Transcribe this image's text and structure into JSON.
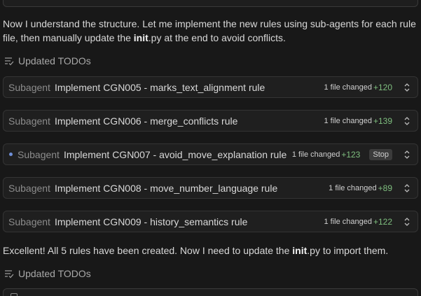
{
  "intro": {
    "before_bold_1": "Now I understand the structure. Let me implement the new rules using sub-agents for each rule file, then manually update the ",
    "bold_1": "init",
    "after_bold_1": ".py at the end to avoid conflicts."
  },
  "todos": [
    {
      "label": "Updated TODOs",
      "icon": "checklist-icon"
    },
    {
      "label": "Updated TODOs",
      "icon": "checklist-icon"
    }
  ],
  "subagents": [
    {
      "prefix": "Subagent",
      "title": "Implement CGN005 - marks_text_alignment rule",
      "changed": "1 file changed",
      "added": "+120",
      "running": false
    },
    {
      "prefix": "Subagent",
      "title": "Implement CGN006 - merge_conflicts rule",
      "changed": "1 file changed",
      "added": "+139",
      "running": false
    },
    {
      "prefix": "Subagent",
      "title": "Implement CGN007 - avoid_move_explanation rule",
      "changed": "1 file changed",
      "added": "+123",
      "running": true,
      "stop_label": "Stop"
    },
    {
      "prefix": "Subagent",
      "title": "Implement CGN008 - move_number_language rule",
      "changed": "1 file changed",
      "added": "+89",
      "running": false
    },
    {
      "prefix": "Subagent",
      "title": "Implement CGN009 - history_semantics rule",
      "changed": "1 file changed",
      "added": "+122",
      "running": false
    }
  ],
  "outro": {
    "before_bold": "Excellent! All 5 rules have been created. Now I need to update the ",
    "bold": "init",
    "after_bold": ".py to import them."
  },
  "colors": {
    "background": "#181818",
    "card": "#1f1f1f",
    "added_green": "#7fbf7f",
    "running_dot": "#6f8fd8"
  }
}
